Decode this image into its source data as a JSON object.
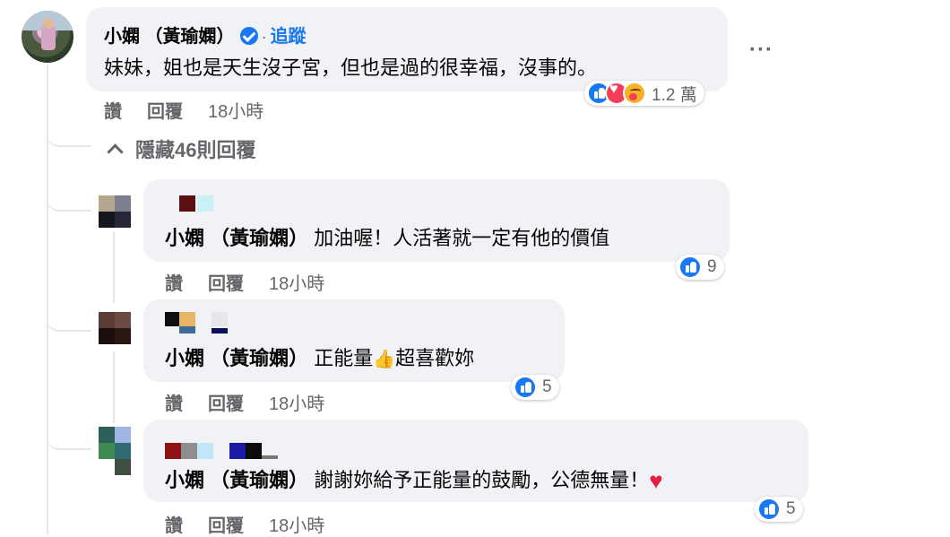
{
  "main_comment": {
    "author": "小嫻 （黃瑜嫻）",
    "follow": "追蹤",
    "separator": "·",
    "text": "妹妹，姐也是天生沒子宮，但也是過的很幸福，沒事的。",
    "like": "讚",
    "reply": "回覆",
    "time": "18小時",
    "reaction_count": "1.2 萬",
    "more": "···"
  },
  "hide_replies": "隱藏46則回覆",
  "replies": [
    {
      "mention": "小嫻 （黃瑜嫻）",
      "text": " 加油喔！人活著就一定有他的價值",
      "like": "讚",
      "reply": "回覆",
      "time": "18小時",
      "reaction_count": "9"
    },
    {
      "mention": "小嫻 （黃瑜嫻）",
      "text": " 正能量",
      "text_after": "超喜歡妳",
      "emoji_icon": "thumbs-up-emoji",
      "like": "讚",
      "reply": "回覆",
      "time": "18小時",
      "reaction_count": "5"
    },
    {
      "mention": "小嫻 （黃瑜嫻）",
      "text": " 謝謝妳給予正能量的鼓勵，公德無量！",
      "emoji_icon": "red-heart-emoji",
      "like": "讚",
      "reply": "回覆",
      "time": "18小時",
      "reaction_count": "5"
    }
  ],
  "colors": {
    "bubble": "#f0f2f5",
    "accent": "#1877f2",
    "secondary_text": "#65676b"
  }
}
